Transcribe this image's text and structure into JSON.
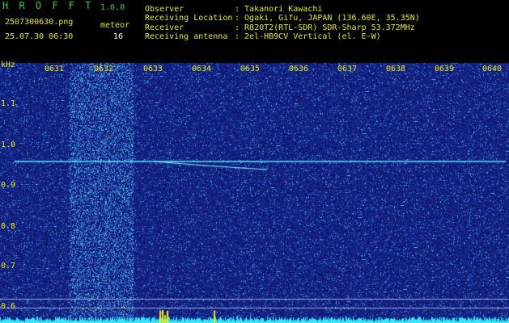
{
  "header": {
    "app_title": "H R O F F T",
    "version": "1.0.0",
    "file_name": "2507300630.png",
    "datetime": "25.07.30 06:30",
    "meteor_label": "meteor",
    "meteor_count": "16",
    "info": [
      {
        "label": "Observer",
        "value": ": Takanori Kawachi"
      },
      {
        "label": "Receiving Location",
        "value": ": Ogaki, Gifu, JAPAN (136.60E, 35.35N)"
      },
      {
        "label": "Receiver",
        "value": ": R820T2(RTL-SDR) SDR-Sharp 53.372MHz"
      },
      {
        "label": "Receiving antenna",
        "value": ": 2el-HB9CV Vertical (el. E-W)"
      }
    ]
  },
  "axis": {
    "unit": "kHz",
    "time_ticks": [
      "0631",
      "0632",
      "0633",
      "0634",
      "0635",
      "0636",
      "0637",
      "0638",
      "0639",
      "0640"
    ],
    "freq_ticks": [
      "1.1",
      "1.0",
      "0.9",
      "0.8",
      "0.7",
      "0.6"
    ]
  },
  "colors": {
    "background": "#000000",
    "label": "#e8e800",
    "spectrogram_base": "#0c1a8a",
    "signal": "#40f0ff"
  }
}
